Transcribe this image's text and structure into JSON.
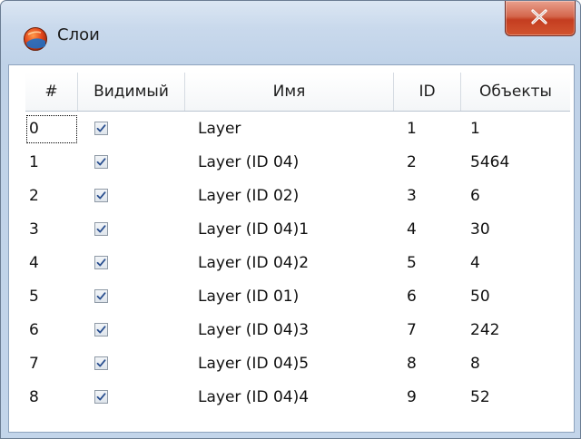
{
  "window": {
    "title": "Слои"
  },
  "table": {
    "headers": {
      "num": "#",
      "visible": "Видимый",
      "name": "Имя",
      "id": "ID",
      "objects": "Объекты"
    },
    "rows": [
      {
        "num": "0",
        "visible": true,
        "name": "Layer",
        "id": "1",
        "objects": "1"
      },
      {
        "num": "1",
        "visible": true,
        "name": "Layer (ID 04)",
        "id": "2",
        "objects": "5464"
      },
      {
        "num": "2",
        "visible": true,
        "name": "Layer (ID 02)",
        "id": "3",
        "objects": "6"
      },
      {
        "num": "3",
        "visible": true,
        "name": "Layer (ID 04)1",
        "id": "4",
        "objects": "30"
      },
      {
        "num": "4",
        "visible": true,
        "name": "Layer (ID 04)2",
        "id": "5",
        "objects": "4"
      },
      {
        "num": "5",
        "visible": true,
        "name": "Layer (ID 01)",
        "id": "6",
        "objects": "50"
      },
      {
        "num": "6",
        "visible": true,
        "name": "Layer (ID 04)3",
        "id": "7",
        "objects": "242"
      },
      {
        "num": "7",
        "visible": true,
        "name": "Layer (ID 04)5",
        "id": "8",
        "objects": "8"
      },
      {
        "num": "8",
        "visible": true,
        "name": "Layer (ID 04)4",
        "id": "9",
        "objects": "52"
      }
    ]
  },
  "colors": {
    "close_button": "#c43d20",
    "checkmark": "#2a4f8f"
  },
  "icons": {
    "app": "layers-globe-icon",
    "close": "close-icon",
    "check": "checkmark-icon"
  }
}
